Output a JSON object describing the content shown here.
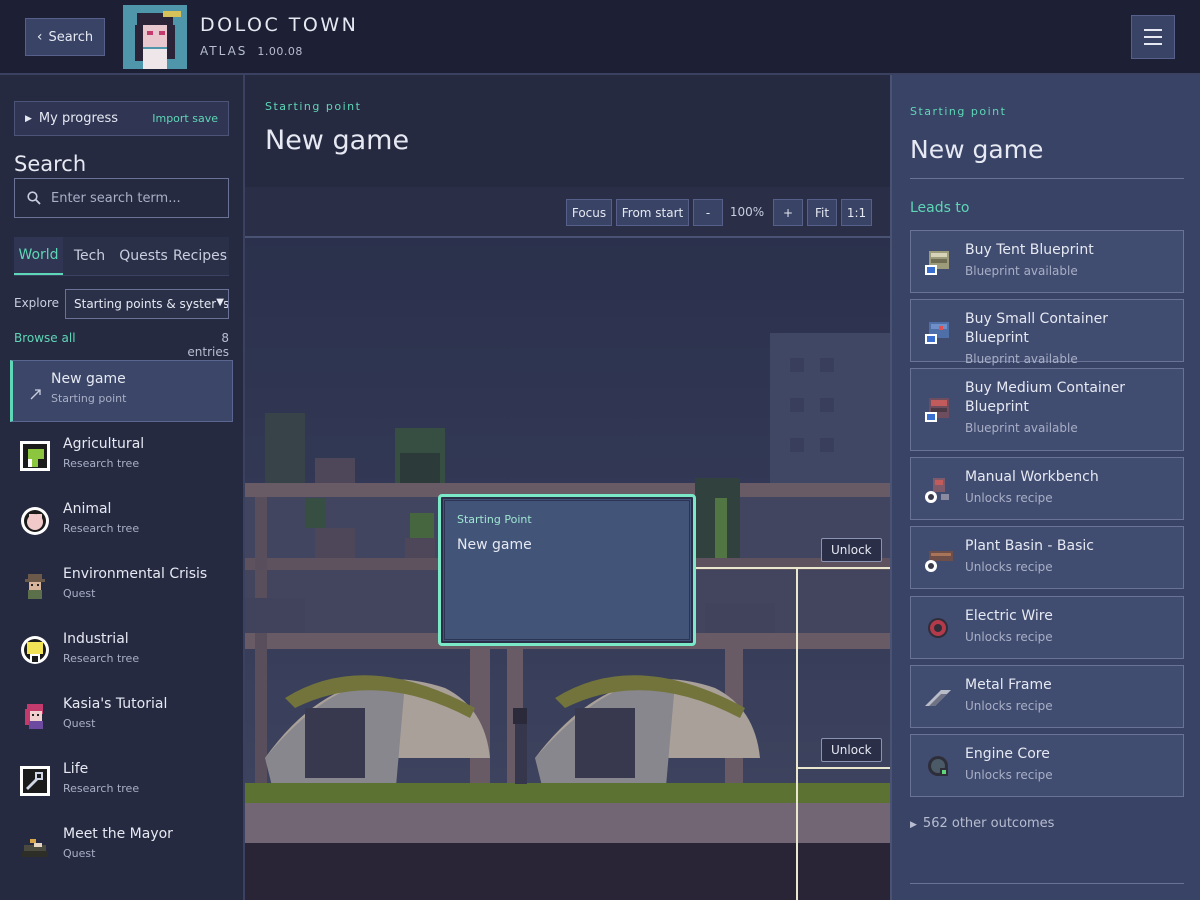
{
  "header": {
    "back_label": "Search",
    "title": "DOLOC TOWN",
    "subtitle": "ATLAS",
    "version": "1.00.08"
  },
  "sidebar": {
    "progress_label": "My progress",
    "import_label": "Import save",
    "search_heading": "Search",
    "search_placeholder": "Enter search term...",
    "tabs": [
      {
        "label": "World",
        "active": true
      },
      {
        "label": "Tech",
        "active": false
      },
      {
        "label": "Quests",
        "active": false
      },
      {
        "label": "Recipes",
        "active": false
      }
    ],
    "explore_label": "Explore",
    "explore_value": "Starting points & systems",
    "browse_all": "Browse all",
    "entries": "8 entries",
    "items": [
      {
        "title": "New game",
        "subtitle": "Starting point",
        "icon": "arrow-icon",
        "selected": true
      },
      {
        "title": "Agricultural",
        "subtitle": "Research tree",
        "icon": "leaf-icon"
      },
      {
        "title": "Animal",
        "subtitle": "Research tree",
        "icon": "animal-icon"
      },
      {
        "title": "Environmental Crisis",
        "subtitle": "Quest",
        "icon": "character-icon"
      },
      {
        "title": "Industrial",
        "subtitle": "Research tree",
        "icon": "industry-icon"
      },
      {
        "title": "Kasia's Tutorial",
        "subtitle": "Quest",
        "icon": "kasia-icon"
      },
      {
        "title": "Life",
        "subtitle": "Research tree",
        "icon": "wrench-icon"
      },
      {
        "title": "Meet the Mayor",
        "subtitle": "Quest",
        "icon": "mayor-icon"
      }
    ]
  },
  "main": {
    "eyebrow": "Starting point",
    "title": "New game",
    "toolbar": {
      "focus": "Focus",
      "from_start": "From start",
      "zoom_out": "-",
      "zoom_level": "100%",
      "zoom_in": "+",
      "fit": "Fit",
      "one_to_one": "1:1"
    },
    "node": {
      "type": "Starting Point",
      "name": "New game"
    },
    "unlock_label": "Unlock"
  },
  "detail": {
    "eyebrow": "Starting point",
    "title": "New game",
    "leads_to": "Leads to",
    "outcomes": [
      {
        "title": "Buy Tent Blueprint",
        "subtitle": "Blueprint available",
        "icon": "tent-blueprint-icon"
      },
      {
        "title": "Buy Small Container Blueprint",
        "subtitle": "Blueprint available",
        "icon": "container-blueprint-icon"
      },
      {
        "title": "Buy Medium Container Blueprint",
        "subtitle": "Blueprint available",
        "icon": "medium-container-blueprint-icon"
      },
      {
        "title": "Manual Workbench",
        "subtitle": "Unlocks recipe",
        "icon": "workbench-icon"
      },
      {
        "title": "Plant Basin - Basic",
        "subtitle": "Unlocks recipe",
        "icon": "plant-basin-icon"
      },
      {
        "title": "Electric Wire",
        "subtitle": "Unlocks recipe",
        "icon": "wire-icon"
      },
      {
        "title": "Metal Frame",
        "subtitle": "Unlocks recipe",
        "icon": "metal-frame-icon"
      },
      {
        "title": "Engine Core",
        "subtitle": "Unlocks recipe",
        "icon": "engine-icon"
      }
    ],
    "more_outcomes": "562 other outcomes"
  },
  "colors": {
    "accent": "#5fd6b6",
    "background": "#262a41",
    "panel": "#384366",
    "node_border": "#7be8c8"
  }
}
